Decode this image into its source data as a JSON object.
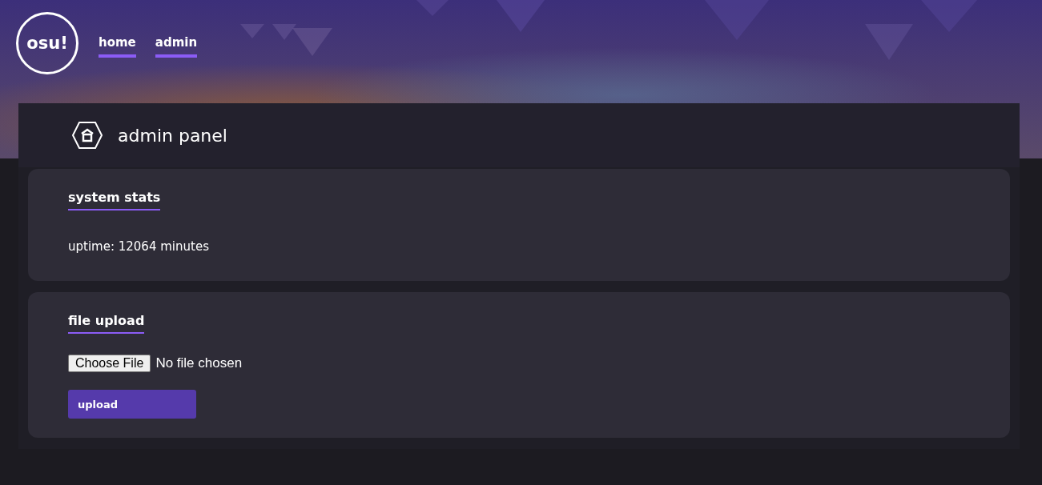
{
  "nav": {
    "logo": "osu!",
    "links": [
      "home",
      "admin"
    ]
  },
  "panel": {
    "title": "admin panel",
    "sections": [
      {
        "kind": "stats",
        "title": "system stats",
        "text": "uptime: 12064 minutes"
      },
      {
        "kind": "upload",
        "title": "file upload",
        "choose_button": "Choose File",
        "file_status": "No file chosen",
        "submit": "upload"
      }
    ]
  }
}
